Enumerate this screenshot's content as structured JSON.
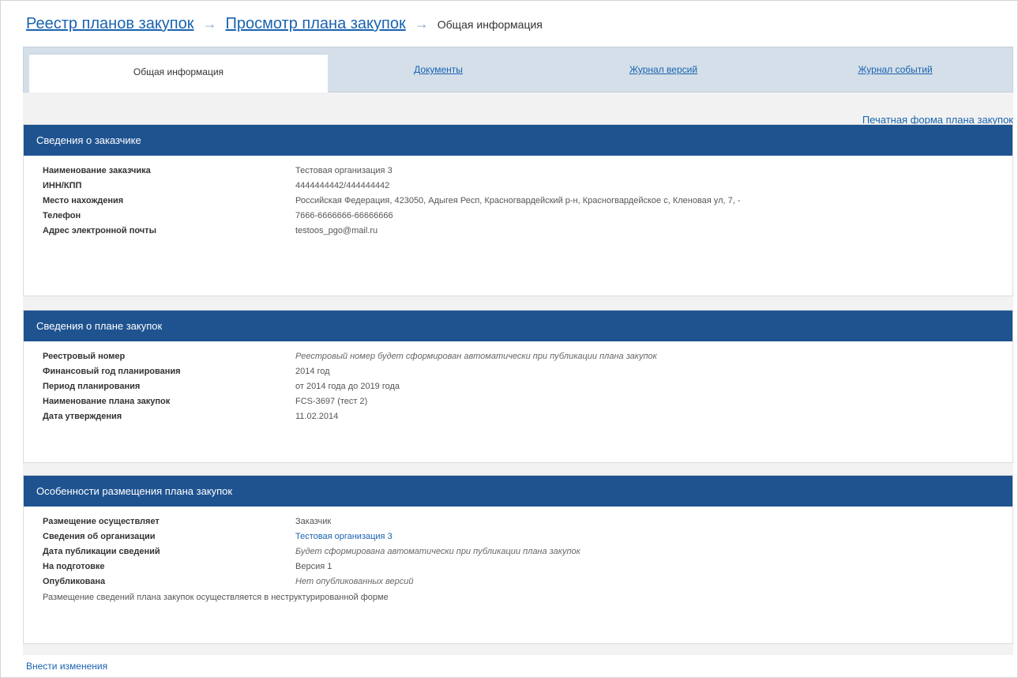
{
  "breadcrumb": {
    "registry": "Реестр планов закупок",
    "view_plan": "Просмотр плана закупок",
    "current": "Общая информация",
    "separator": "→"
  },
  "tabs": {
    "general": "Общая информация",
    "documents": "Документы",
    "versions": "Журнал версий",
    "events": "Журнал событий"
  },
  "print_link": "Печатная форма плана закупок",
  "customer": {
    "title": "Сведения о заказчике",
    "rows": [
      {
        "label": "Наименование заказчика",
        "value": "Тестовая организация 3"
      },
      {
        "label": "ИНН/КПП",
        "value": "4444444442/444444442"
      },
      {
        "label": "Место нахождения",
        "value": "Российская Федерация, 423050, Адыгея Респ, Красногвардейский р-н, Красногвардейское с, Кленовая ул, 7, -"
      },
      {
        "label": "Телефон",
        "value": "7666-6666666-66666666"
      },
      {
        "label": "Адрес электронной почты",
        "value": "testoos_pgo@mail.ru"
      }
    ]
  },
  "plan": {
    "title": "Сведения о плане закупок",
    "rows": [
      {
        "label": "Реестровый номер",
        "value": "Реестровый номер будет сформирован автоматически при публикации плана закупок"
      },
      {
        "label": "Финансовый год планирования",
        "value": "2014 год"
      },
      {
        "label": "Период планирования",
        "value": "от 2014 года до 2019 года"
      },
      {
        "label": "Наименование плана закупок",
        "value": "FCS-3697 (тест 2)"
      },
      {
        "label": "Дата утверждения",
        "value": "11.02.2014"
      }
    ]
  },
  "placement": {
    "title": "Особенности размещения плана закупок",
    "rows": [
      {
        "label": "Размещение осуществляет",
        "value": "Заказчик"
      },
      {
        "label": "Сведения об организации",
        "value": "Тестовая организация 3"
      },
      {
        "label": "Дата публикации сведений",
        "value": "Будет сформирована автоматически при публикации плана закупок"
      },
      {
        "label": "На подготовке",
        "value": "Версия 1"
      },
      {
        "label": "Опубликована",
        "value": "Нет опубликованных версий"
      }
    ],
    "note": "Размещение сведений плана закупок осуществляется в неструктурированной форме"
  },
  "bottom_link": "Внести изменения"
}
